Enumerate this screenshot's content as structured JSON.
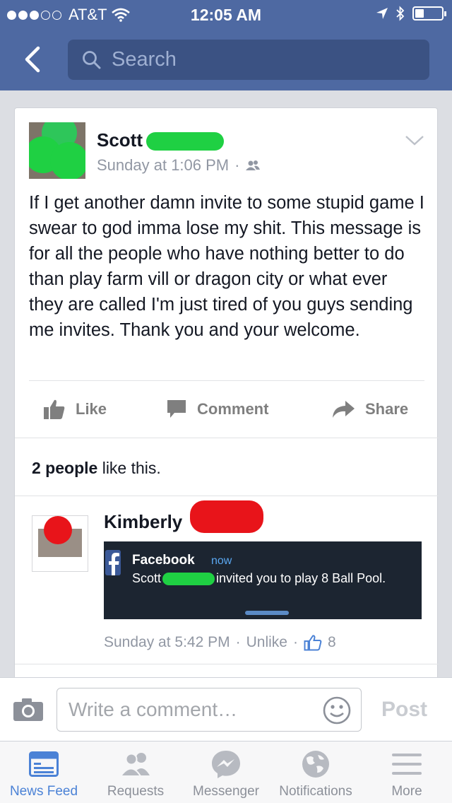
{
  "status": {
    "carrier": "AT&T",
    "time": "12:05 AM"
  },
  "nav": {
    "search_placeholder": "Search"
  },
  "post": {
    "author": "Scott",
    "timestamp": "Sunday at 1:06 PM",
    "separator": "·",
    "text": "If I get another damn invite to some stupid game I swear to god imma lose my shit. This message is for all the people who have nothing better to do than play farm vill or dragon city or what ever they are called I'm just tired of you guys sending me invites. Thank you and your welcome.",
    "actions": {
      "like": "Like",
      "comment": "Comment",
      "share": "Share"
    },
    "likes_bold": "2 people",
    "likes_rest": " like this."
  },
  "comment": {
    "author": "Kimberly",
    "notification": {
      "app": "Facebook",
      "time": "now",
      "sender": "Scott",
      "message": "invited you to play 8 Ball Pool."
    },
    "timestamp": "Sunday at 5:42 PM",
    "separator": "·",
    "unlike": "Unlike",
    "separator2": "·",
    "like_count": "8"
  },
  "composer": {
    "placeholder": "Write a comment…",
    "post_label": "Post"
  },
  "tabs": [
    {
      "label": "News Feed",
      "icon": "news-feed-icon",
      "active": true
    },
    {
      "label": "Requests",
      "icon": "friend-requests-icon",
      "active": false
    },
    {
      "label": "Messenger",
      "icon": "messenger-icon",
      "active": false
    },
    {
      "label": "Notifications",
      "icon": "globe-icon",
      "active": false
    },
    {
      "label": "More",
      "icon": "menu-icon",
      "active": false
    }
  ],
  "colors": {
    "brand": "#4e69a2",
    "accent": "#4b82d6",
    "redact_green": "#1fd043",
    "redact_red": "#e8141a"
  }
}
